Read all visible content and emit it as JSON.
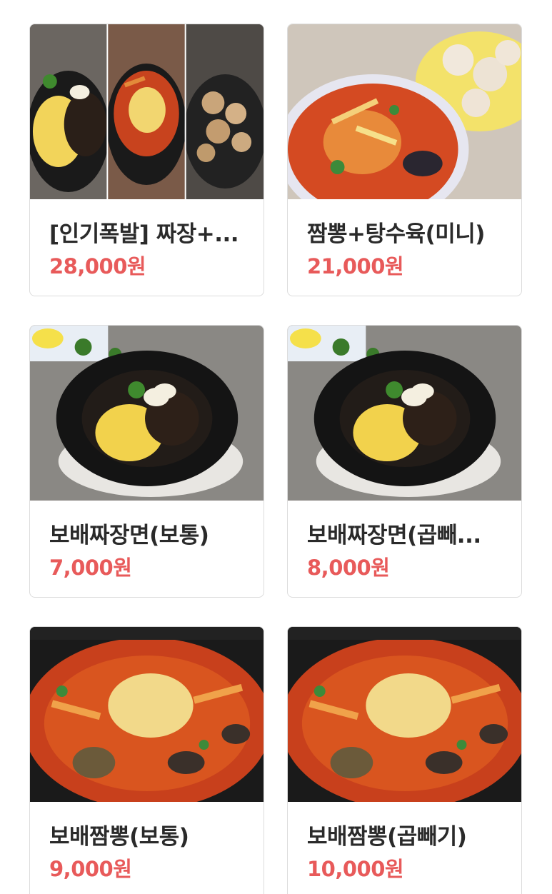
{
  "menu": {
    "items": [
      {
        "name": "[인기폭발] 짜장+...",
        "price": "28,000원",
        "image": "set-combo-image"
      },
      {
        "name": "짬뽕+탕수육(미니)",
        "price": "21,000원",
        "image": "jjamppong-tangsuyuk-image"
      },
      {
        "name": "보배짜장면(보통)",
        "price": "7,000원",
        "image": "jjajangmyeon-image"
      },
      {
        "name": "보배짜장면(곱빼...",
        "price": "8,000원",
        "image": "jjajangmyeon-image"
      },
      {
        "name": "보배짬뽕(보통)",
        "price": "9,000원",
        "image": "jjamppong-image"
      },
      {
        "name": "보배짬뽕(곱빼기)",
        "price": "10,000원",
        "image": "jjamppong-image"
      }
    ]
  },
  "colors": {
    "price": "#e85a5a",
    "name": "#2a2a2a",
    "border": "#dcdcdc"
  }
}
